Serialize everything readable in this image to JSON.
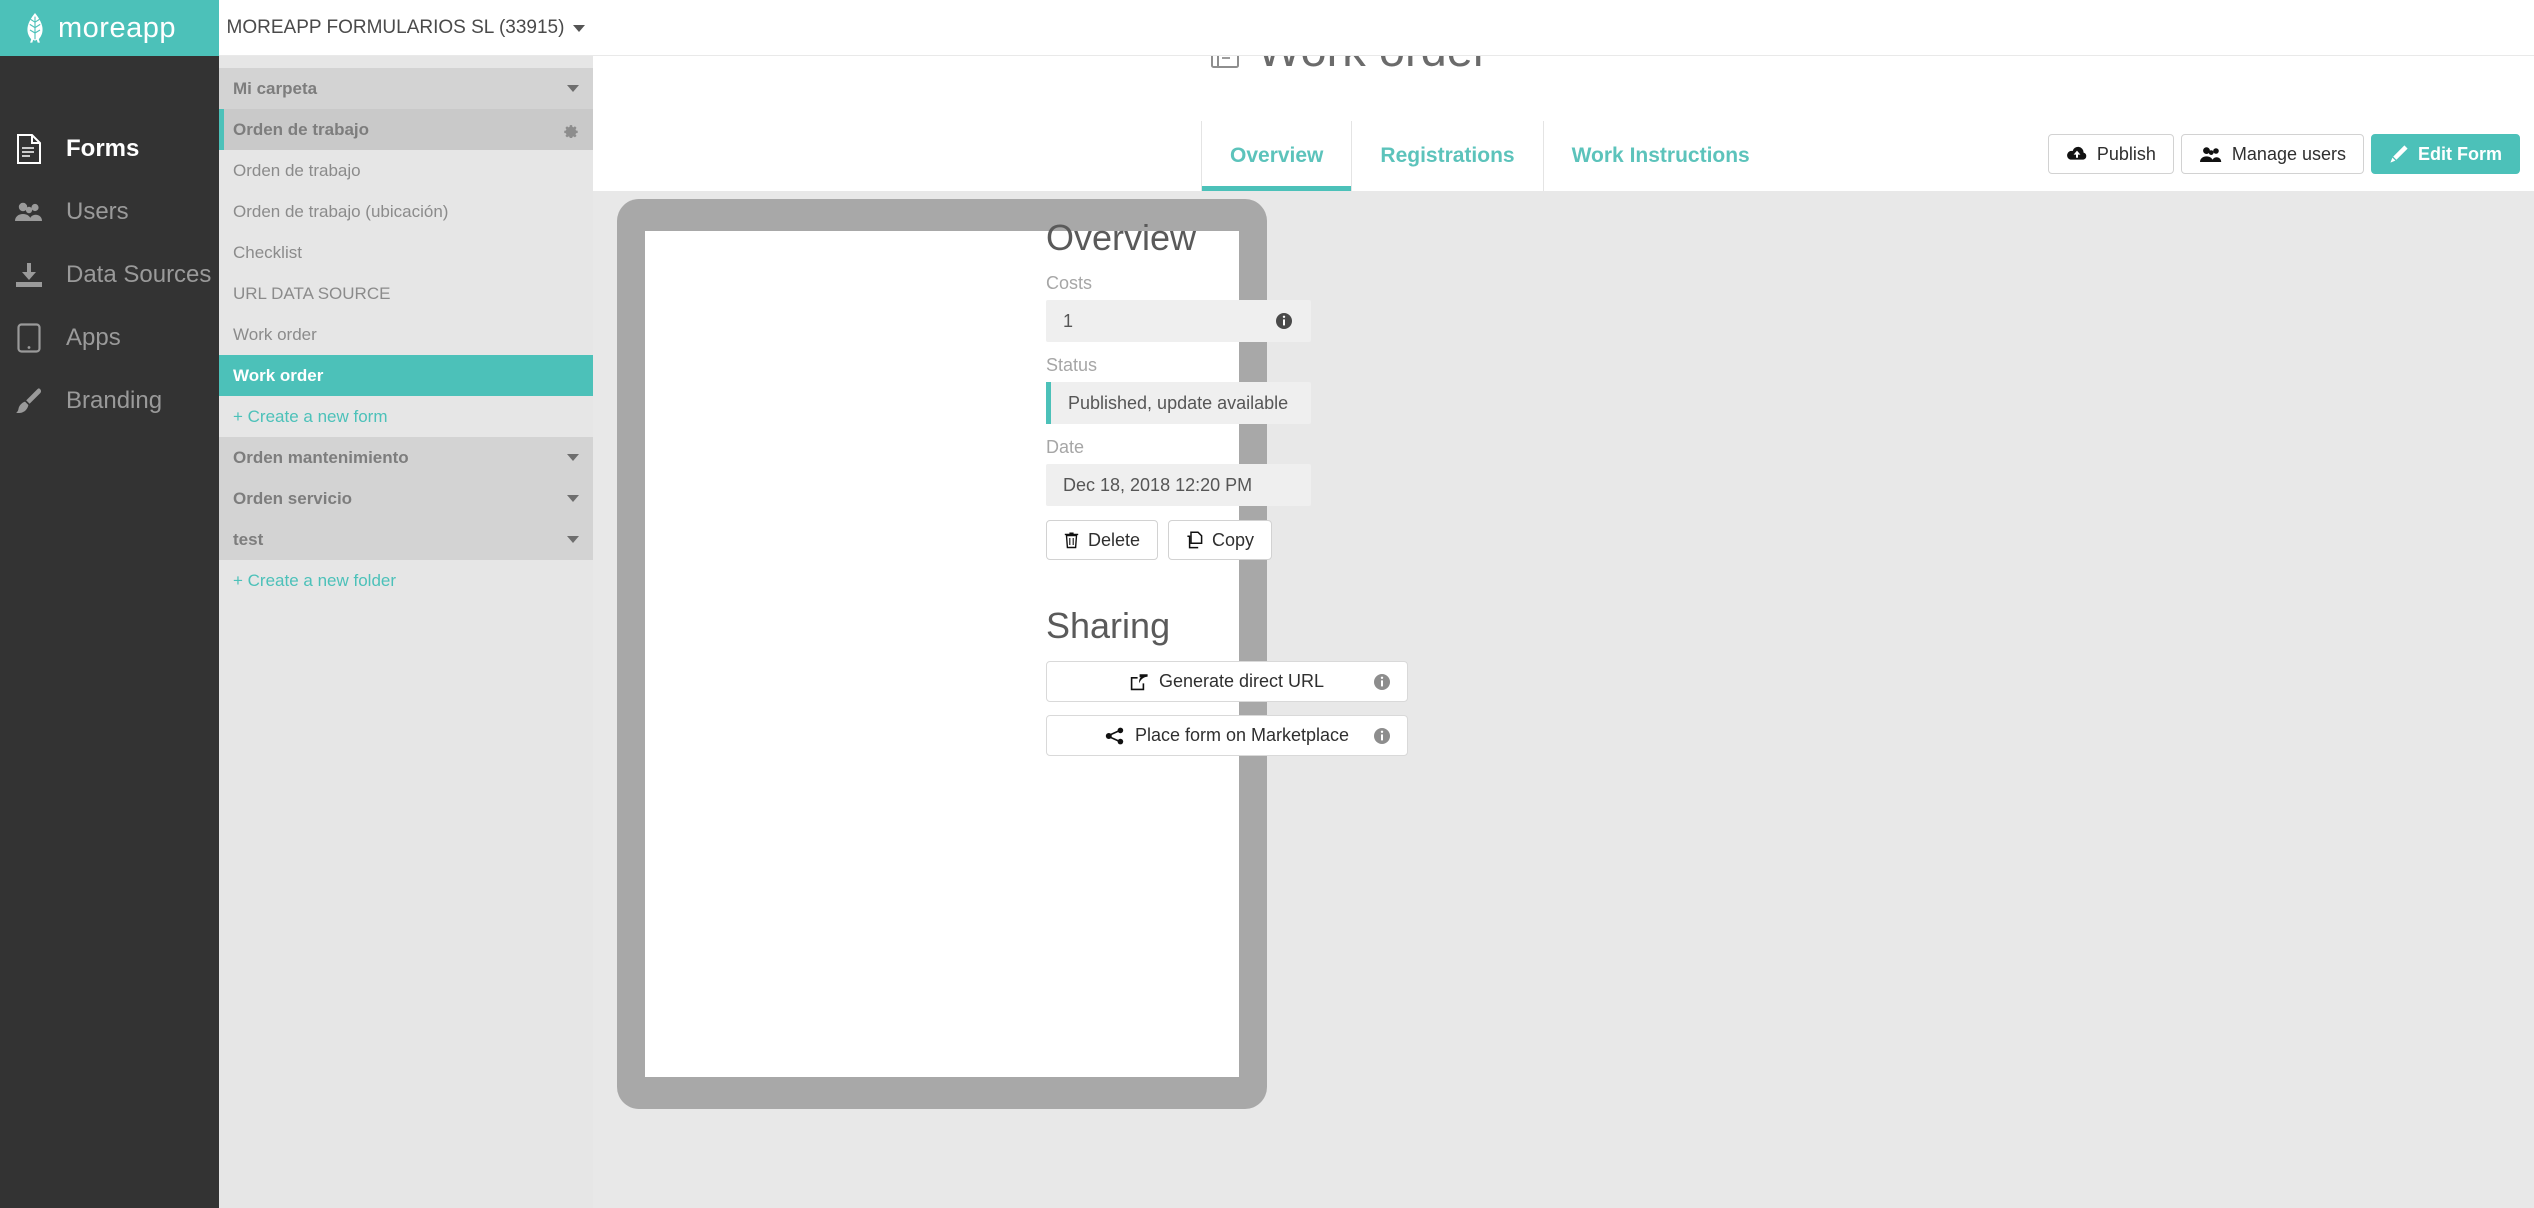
{
  "brand": {
    "name": "moreapp",
    "logo_icon": "leaf-icon",
    "accent_color": "#4cc1b9"
  },
  "account": {
    "name": "MOREAPP FORMULARIOS SL (33915)",
    "caret_icon": "chevron-down-icon"
  },
  "nav": {
    "items": [
      {
        "label": "Forms",
        "icon": "document-icon",
        "active": true
      },
      {
        "label": "Users",
        "icon": "users-icon",
        "active": false
      },
      {
        "label": "Data Sources",
        "icon": "download-icon",
        "active": false
      },
      {
        "label": "Apps",
        "icon": "tablet-icon",
        "active": false
      },
      {
        "label": "Branding",
        "icon": "brush-icon",
        "active": false
      }
    ]
  },
  "tree": {
    "search": {
      "value": "",
      "placeholder": "",
      "icon": "search-icon"
    },
    "create_form_label": "+ Create a new form",
    "create_folder_label": "+ Create a new folder",
    "folders": [
      {
        "label": "Mi carpeta",
        "open": false,
        "icon": "chevron-down-icon"
      },
      {
        "label": "Orden de trabajo",
        "open": true,
        "icon": "gear-icon"
      },
      {
        "label": "Orden mantenimiento",
        "open": false,
        "icon": "chevron-down-icon"
      },
      {
        "label": "Orden servicio",
        "open": false,
        "icon": "chevron-down-icon"
      },
      {
        "label": "test",
        "open": false,
        "icon": "chevron-down-icon"
      }
    ],
    "forms": [
      {
        "label": "Orden de trabajo",
        "selected": false
      },
      {
        "label": "Orden de trabajo (ubicación)",
        "selected": false
      },
      {
        "label": "Checklist",
        "selected": false
      },
      {
        "label": "URL DATA SOURCE",
        "selected": false
      },
      {
        "label": "Work order",
        "selected": false
      },
      {
        "label": "Work order",
        "selected": true
      }
    ]
  },
  "page": {
    "title": "Work order",
    "icon": "form-document-icon"
  },
  "tabs": [
    {
      "label": "Overview",
      "active": true
    },
    {
      "label": "Registrations",
      "active": false
    },
    {
      "label": "Work Instructions",
      "active": false
    }
  ],
  "header_actions": [
    {
      "label": "Publish",
      "icon": "cloud-upload-icon",
      "primary": false
    },
    {
      "label": "Manage users",
      "icon": "users-icon",
      "primary": false
    },
    {
      "label": "Edit Form",
      "icon": "pencil-icon",
      "primary": true
    }
  ],
  "overview": {
    "title": "Overview",
    "costs_label": "Costs",
    "costs_value": "1",
    "status_label": "Status",
    "status_value": "Published, update available",
    "status_accent": "#4cc1b9",
    "date_label": "Date",
    "date_value": "Dec 18, 2018 12:20 PM",
    "delete_label": "Delete",
    "delete_icon": "trash-icon",
    "copy_label": "Copy",
    "copy_icon": "copy-icon",
    "info_icon": "info-icon"
  },
  "sharing": {
    "title": "Sharing",
    "buttons": [
      {
        "label": "Generate direct URL",
        "icon": "external-link-icon",
        "info_icon": "info-icon"
      },
      {
        "label": "Place form on Marketplace",
        "icon": "share-icon",
        "info_icon": "info-icon"
      }
    ]
  },
  "preview": {
    "name": "device-preview",
    "screen_color": "#ffffff",
    "frame_color": "#a8a8a8"
  }
}
